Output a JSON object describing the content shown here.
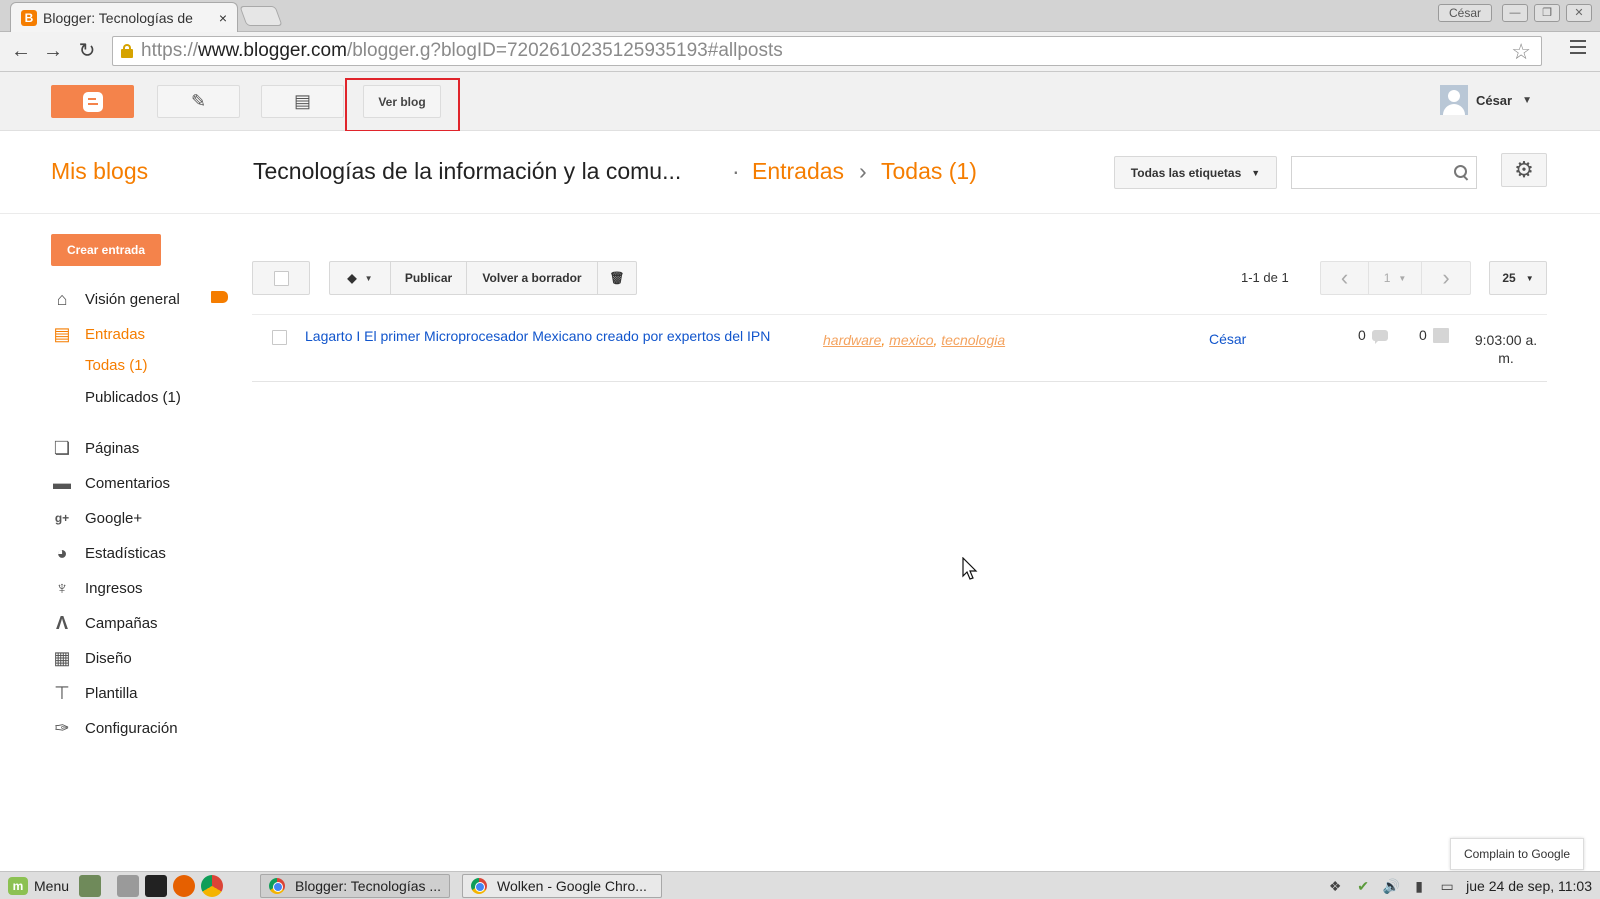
{
  "browser": {
    "tab_title": "Blogger: Tecnologías de",
    "tab_close": "×",
    "favicon_letter": "B",
    "profile_name": "César",
    "url_scheme": "https://",
    "url_host": "www.blogger.com",
    "url_path": "/blogger.g?blogID=7202610235125935193#allposts"
  },
  "topbar": {
    "view_blog_label": "Ver blog",
    "account_name": "César"
  },
  "header": {
    "my_blogs": "Mis blogs",
    "blog_title": "Tecnologías de la información y la comu...",
    "breadcrumb_sep": "·",
    "breadcrumb_section": "Entradas",
    "breadcrumb_arrow": "›",
    "breadcrumb_current": "Todas (1)",
    "labels_filter": "Todas las etiquetas",
    "search_placeholder": ""
  },
  "sidebar": {
    "create_post": "Crear entrada",
    "items": [
      {
        "label": "Visión general",
        "icon": "home-icon"
      },
      {
        "label": "Entradas",
        "icon": "posts-icon"
      },
      {
        "label": "Páginas",
        "icon": "pages-icon"
      },
      {
        "label": "Comentarios",
        "icon": "comments-icon"
      },
      {
        "label": "Google+",
        "icon": "google-plus-icon"
      },
      {
        "label": "Estadísticas",
        "icon": "stats-pie-icon"
      },
      {
        "label": "Ingresos",
        "icon": "trophy-icon"
      },
      {
        "label": "Campañas",
        "icon": "adwords-icon"
      },
      {
        "label": "Diseño",
        "icon": "layout-icon"
      },
      {
        "label": "Plantilla",
        "icon": "paint-roller-icon"
      },
      {
        "label": "Configuración",
        "icon": "wrench-icon"
      }
    ],
    "sub_items": [
      {
        "label": "Todas (1)"
      },
      {
        "label": "Publicados (1)"
      }
    ]
  },
  "toolbar": {
    "publish": "Publicar",
    "revert_draft": "Volver a borrador",
    "range_text": "1-1 de 1",
    "page": "1",
    "per_page": "25"
  },
  "posts": [
    {
      "title": "Lagarto I El primer Microprocesador Mexicano creado por expertos del IPN",
      "labels": [
        "hardware",
        "mexico",
        "tecnologia"
      ],
      "author": "César",
      "comments": "0",
      "views": "0",
      "time": "9:03:00 a. m."
    }
  ],
  "footer": {
    "complain": "Complain to Google"
  },
  "taskbar": {
    "menu": "Menu",
    "windows": [
      "Blogger: Tecnologías ...",
      "Wolken - Google Chro..."
    ],
    "clock": "jue 24 de sep, 11:03"
  },
  "colors": {
    "accent": "#f57d00",
    "link": "#1155cc",
    "highlight": "#e0242b"
  }
}
